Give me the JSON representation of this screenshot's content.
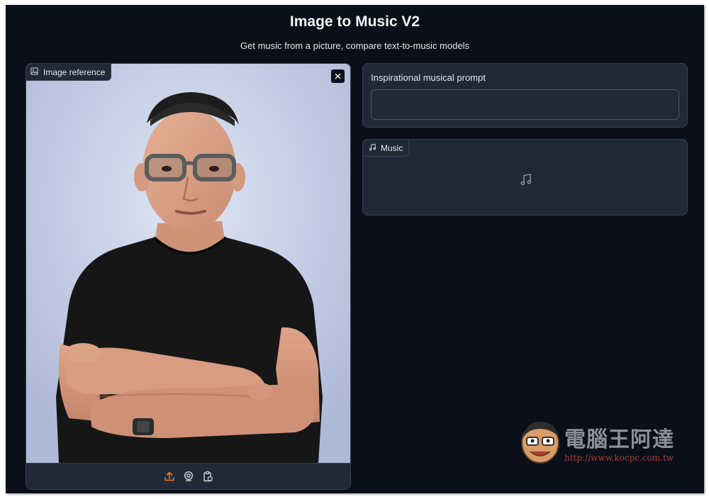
{
  "app": {
    "title": "Image to Music V2",
    "subtitle": "Get music from a picture, compare text-to-music models"
  },
  "image_input": {
    "label": "Image reference",
    "icon": "image-icon",
    "clear_icon": "close-icon",
    "toolbar": [
      "upload-icon",
      "webcam-icon",
      "clipboard-icon"
    ]
  },
  "prompt": {
    "label": "Inspirational musical prompt",
    "value": ""
  },
  "music_output": {
    "label": "Music",
    "icon": "music-note-icon"
  },
  "watermark": {
    "name": "電腦王阿達",
    "url": "http://www.kocpc.com.tw"
  },
  "colors": {
    "background": "#0b0f19",
    "panel": "#1f2937",
    "border": "#374151",
    "accent": "#f97316"
  }
}
